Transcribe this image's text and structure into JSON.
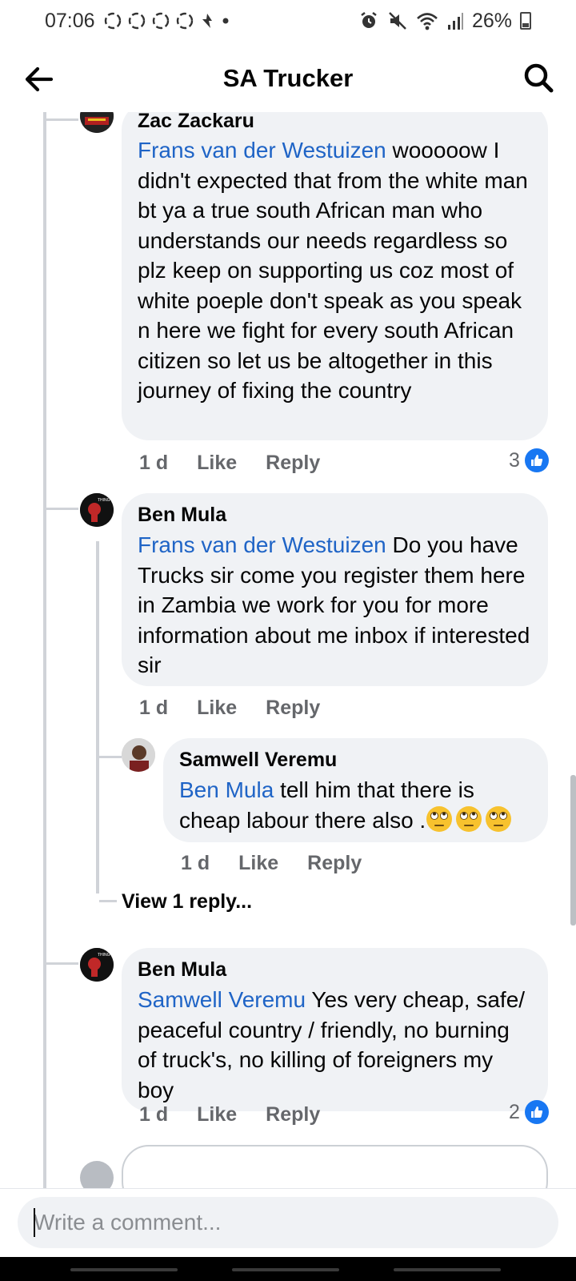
{
  "status_bar": {
    "time": "07:06",
    "battery": "26%",
    "left_icons": [
      "recycle-icon",
      "recycle-icon",
      "recycle-icon",
      "recycle-icon",
      "notification-icon",
      "dot-icon"
    ],
    "right_icons": [
      "alarm-icon",
      "mute-icon",
      "wifi-icon",
      "signal-icon"
    ]
  },
  "header": {
    "title": "SA Trucker"
  },
  "comments": [
    {
      "author": "Zac Zackaru",
      "mention": "Frans van der Westuizen",
      "text": " wooooow I didn't expected that from the white man bt ya a true south African man who understands our needs regardless so plz keep on supporting us coz most of white poeple don't speak as you speak n here we fight for every south African citizen so let us be altogether in this journey of fixing the country",
      "time": "1 d",
      "like": "Like",
      "reply": "Reply",
      "reaction_count": "3"
    },
    {
      "author": "Ben Mula",
      "mention": "Frans van der Westuizen",
      "text": " Do you have Trucks sir come you register them here in Zambia we work for you for more information about me inbox if interested sir",
      "time": "1 d",
      "like": "Like",
      "reply": "Reply"
    },
    {
      "author": "Samwell Veremu",
      "mention": "Ben Mula",
      "text": " tell him that there is cheap labour there also .",
      "emoji_count": 3,
      "time": "1 d",
      "like": "Like",
      "reply": "Reply"
    },
    {
      "author": "Ben Mula",
      "mention": "Samwell Veremu",
      "text": " Yes very cheap, safe/ peaceful country / friendly, no burning of truck's, no killing of foreigners my boy",
      "time": "1 d",
      "like": "Like",
      "reply": "Reply",
      "reaction_count": "2"
    }
  ],
  "view_replies": "View 1 reply...",
  "composer": {
    "placeholder": "Write a comment..."
  },
  "colors": {
    "mention": "#1f64c6",
    "bubble": "#f0f2f5",
    "like_badge": "#1877f2",
    "meta": "#65676b"
  }
}
